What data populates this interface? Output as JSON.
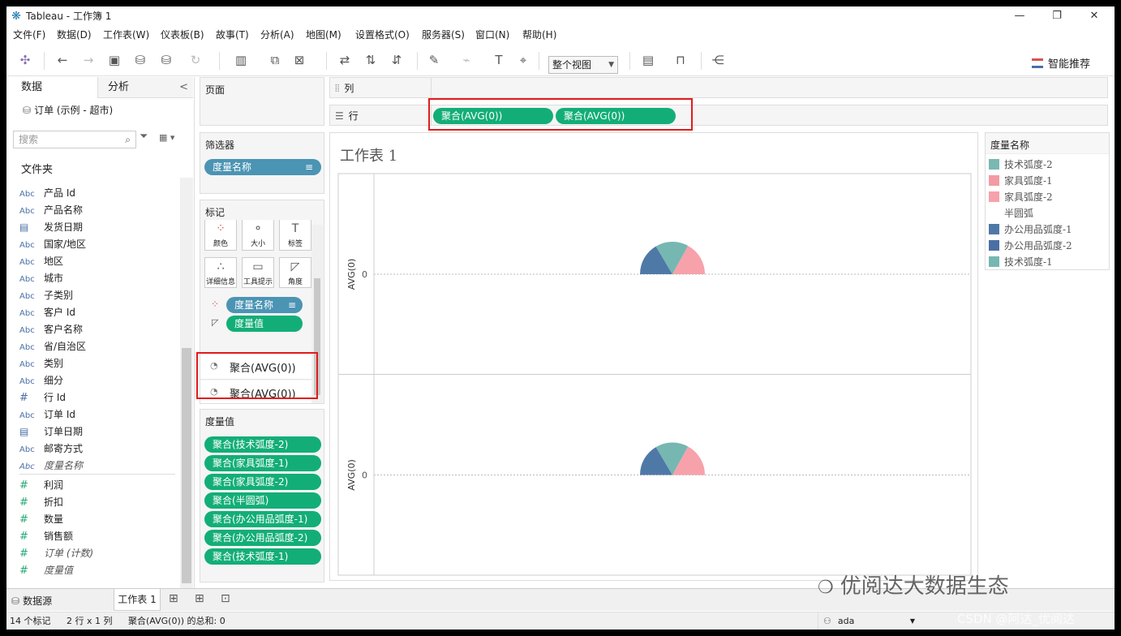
{
  "window": {
    "title": "Tableau - 工作簿 1",
    "minimize": "—",
    "maximize": "❐",
    "close": "✕"
  },
  "menu": [
    "文件(F)",
    "数据(D)",
    "工作表(W)",
    "仪表板(B)",
    "故事(T)",
    "分析(A)",
    "地图(M)",
    "设置格式(O)",
    "服务器(S)",
    "窗口(N)",
    "帮助(H)"
  ],
  "toolbar": {
    "fit_value": "整个视图",
    "smart_label": "智能推荐"
  },
  "data_pane": {
    "tab_data": "数据",
    "tab_analysis": "分析",
    "collapse": "<",
    "datasource": "订单 (示例 - 超市)",
    "search_placeholder": "搜索",
    "folder_label": "文件夹",
    "dimensions": [
      {
        "type": "Abc",
        "label": "产品 Id"
      },
      {
        "type": "Abc",
        "label": "产品名称"
      },
      {
        "type": "date",
        "label": "发货日期"
      },
      {
        "type": "Abc",
        "label": "国家/地区"
      },
      {
        "type": "Abc",
        "label": "地区"
      },
      {
        "type": "Abc",
        "label": "城市"
      },
      {
        "type": "Abc",
        "label": "子类别"
      },
      {
        "type": "Abc",
        "label": "客户 Id"
      },
      {
        "type": "Abc",
        "label": "客户名称"
      },
      {
        "type": "Abc",
        "label": "省/自治区"
      },
      {
        "type": "Abc",
        "label": "类别"
      },
      {
        "type": "Abc",
        "label": "细分"
      },
      {
        "type": "#",
        "label": "行 Id"
      },
      {
        "type": "Abc",
        "label": "订单 Id"
      },
      {
        "type": "date",
        "label": "订单日期"
      },
      {
        "type": "Abc",
        "label": "邮寄方式"
      },
      {
        "type": "Abc",
        "label": "度量名称"
      }
    ],
    "measures": [
      {
        "type": "#",
        "label": "利润"
      },
      {
        "type": "#",
        "label": "折扣"
      },
      {
        "type": "#",
        "label": "数量"
      },
      {
        "type": "#",
        "label": "销售额"
      },
      {
        "type": "#",
        "label": "订单 (计数)"
      },
      {
        "type": "#",
        "label": "度量值"
      }
    ]
  },
  "pages": {
    "title": "页面"
  },
  "filters": {
    "title": "筛选器",
    "pill": "度量名称"
  },
  "marks": {
    "title": "标记",
    "buttons": [
      "颜色",
      "大小",
      "标签",
      "详细信息",
      "工具提示",
      "角度"
    ],
    "pill_color": "度量名称",
    "pill_angle": "度量值",
    "layers": [
      "聚合(AVG(0))",
      "聚合(AVG(0))"
    ]
  },
  "measure_values": {
    "title": "度量值",
    "pills": [
      "聚合(技术弧度-2)",
      "聚合(家具弧度-1)",
      "聚合(家具弧度-2)",
      "聚合(半圆弧)",
      "聚合(办公用品弧度-1)",
      "聚合(办公用品弧度-2)",
      "聚合(技术弧度-1)"
    ]
  },
  "shelves": {
    "columns_label": "列",
    "rows_label": "行",
    "rows_pills": [
      "聚合(AVG(0))",
      "聚合(AVG(0))"
    ]
  },
  "view": {
    "title": "工作表 1",
    "axis_label": "AVG(0)",
    "axis_tick": "0"
  },
  "legend": {
    "title": "度量名称",
    "items": [
      {
        "label": "技术弧度-2",
        "color": "#7ab8b2"
      },
      {
        "label": "家具弧度-1",
        "color": "#f39ba3"
      },
      {
        "label": "家具弧度-2",
        "color": "#f7a1ab"
      },
      {
        "label": "半圆弧",
        "color": "#ffffff"
      },
      {
        "label": "办公用品弧度-1",
        "color": "#4e79a7"
      },
      {
        "label": "办公用品弧度-2",
        "color": "#4a6fa5"
      },
      {
        "label": "技术弧度-1",
        "color": "#76b7b2"
      }
    ]
  },
  "sheet_tabs": {
    "datasource": "数据源",
    "sheet": "工作表 1"
  },
  "status": {
    "marks": "14 个标记",
    "dims": "2 行 x 1 列",
    "sum": "聚合(AVG(0)) 的总和: 0",
    "user": "ada"
  },
  "watermark": {
    "brand": "优阅达大数据生态",
    "csdn": "CSDN @阿达_优阅达"
  },
  "chart_data": {
    "type": "pie",
    "layout": "2 rows of half-circle pies",
    "rows": 2,
    "series": [
      {
        "name": "办公用品弧度-1/2",
        "share": 0.33,
        "color": "#4e79a7"
      },
      {
        "name": "技术弧度",
        "share": 0.33,
        "color": "#76b7b2"
      },
      {
        "name": "家具弧度",
        "share": 0.34,
        "color": "#f7a1ab"
      }
    ],
    "ylabel": "AVG(0)",
    "yticks": [
      "0"
    ]
  }
}
